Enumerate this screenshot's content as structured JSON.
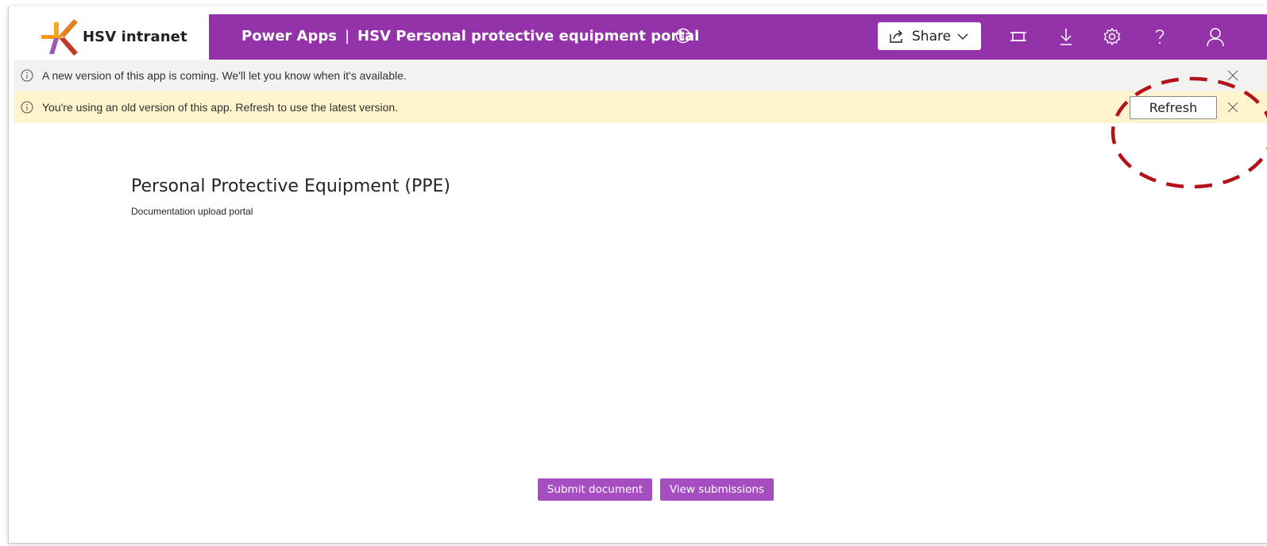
{
  "header": {
    "logo_text": "HSV intranet",
    "app_name": "Power Apps",
    "separator": "|",
    "app_title": "HSV Personal protective equipment portal",
    "share_label": "Share",
    "icons": [
      "info-icon",
      "share-icon",
      "chevron-down-icon",
      "fit-screen-icon",
      "download-icon",
      "settings-icon",
      "help-icon",
      "user-icon"
    ],
    "bar_color": "#9433a9"
  },
  "banners": {
    "info": {
      "message": "A new version of this app is coming. We'll let you know when it's available."
    },
    "warning": {
      "message": "You're using an old version of this app. Refresh to use the latest version.",
      "refresh_label": "Refresh"
    }
  },
  "main": {
    "title": "Personal Protective Equipment (PPE)",
    "subtitle": "Documentation upload portal",
    "submit_label": "Submit document",
    "view_label": "View submissions",
    "button_color": "#a64ec1"
  },
  "annotation": {
    "color": "#b3121b",
    "shape": "dashed-ellipse"
  }
}
